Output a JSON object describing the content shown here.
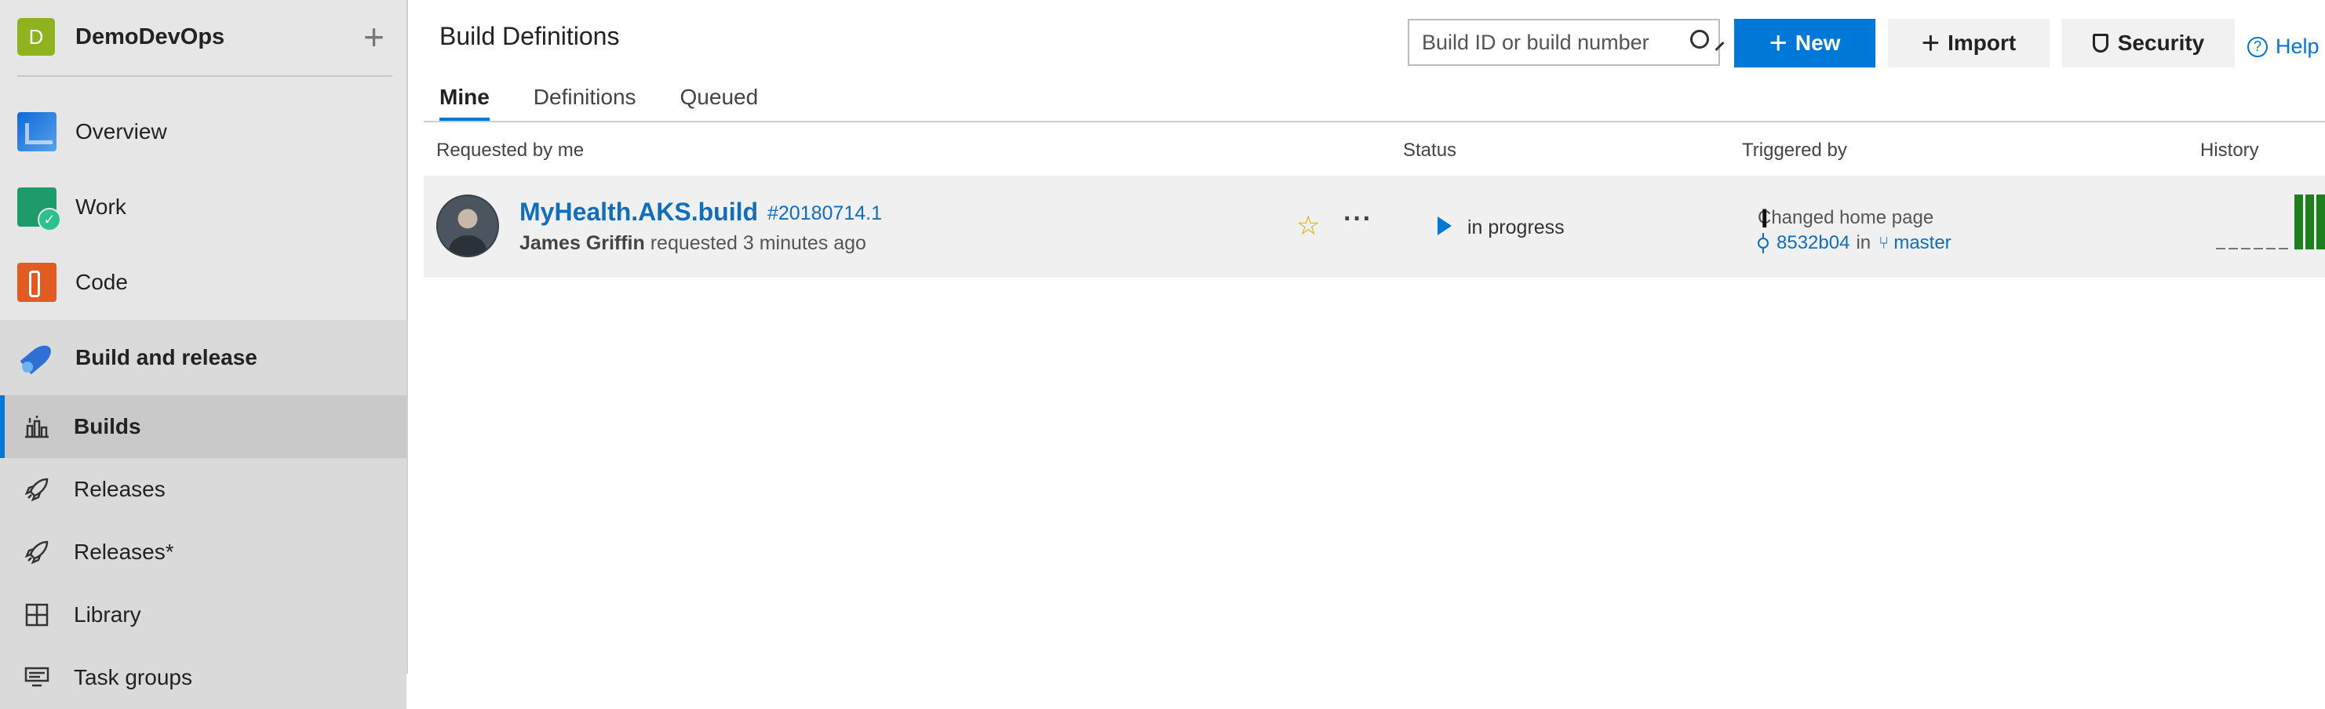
{
  "sidebar": {
    "project": {
      "initial": "D",
      "name": "DemoDevOps",
      "add_icon": "plus-icon"
    },
    "hubs": [
      {
        "label": "Overview",
        "icon": "overview-icon"
      },
      {
        "label": "Work",
        "icon": "work-icon"
      },
      {
        "label": "Code",
        "icon": "code-icon"
      },
      {
        "label": "Build and release",
        "icon": "build-release-icon"
      }
    ],
    "sub_items": [
      {
        "label": "Builds",
        "icon": "builds-icon"
      },
      {
        "label": "Releases",
        "icon": "rocket-icon"
      },
      {
        "label": "Releases*",
        "icon": "rocket-icon"
      },
      {
        "label": "Library",
        "icon": "library-icon"
      },
      {
        "label": "Task groups",
        "icon": "task-groups-icon"
      }
    ]
  },
  "header": {
    "title": "Build Definitions",
    "search_placeholder": "Build ID or build number",
    "new_label": "New",
    "import_label": "Import",
    "security_label": "Security",
    "help_label": "Help",
    "accent": "#0078d7"
  },
  "tabs": [
    "Mine",
    "Definitions",
    "Queued"
  ],
  "columns": {
    "requested": "Requested by me",
    "status": "Status",
    "triggered": "Triggered by",
    "history": "History"
  },
  "build_row": {
    "definition": "MyHealth.AKS.build",
    "separator": ":",
    "build_number": "#20180714.1",
    "requester": "James Griffin",
    "requested_text": "requested 3 minutes ago",
    "status": "in progress",
    "commit_message": "Changed home page",
    "commit": "8532b04",
    "in_word": "in",
    "branch": "master"
  }
}
